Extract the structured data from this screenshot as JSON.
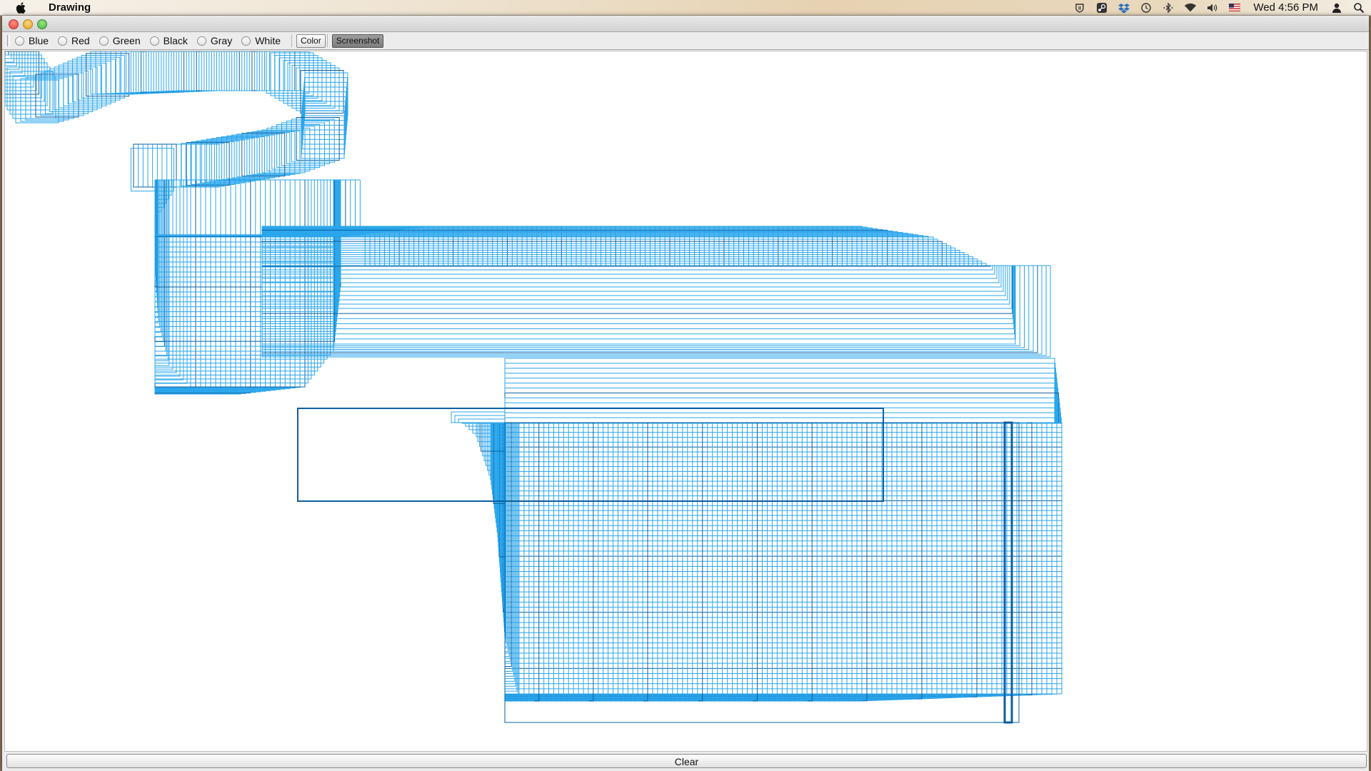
{
  "app": {
    "name": "Drawing"
  },
  "menubar": {
    "clock": "Wed 4:56 PM"
  },
  "toolbar": {
    "color_options": [
      "Blue",
      "Red",
      "Green",
      "Black",
      "Gray",
      "White"
    ],
    "color_button": "Color",
    "screenshot_button": "Screenshot"
  },
  "bottom": {
    "clear_label": "Clear"
  },
  "colors": {
    "stroke_primary": "#2aa6ec",
    "stroke_dark": "#0d5fa0"
  }
}
